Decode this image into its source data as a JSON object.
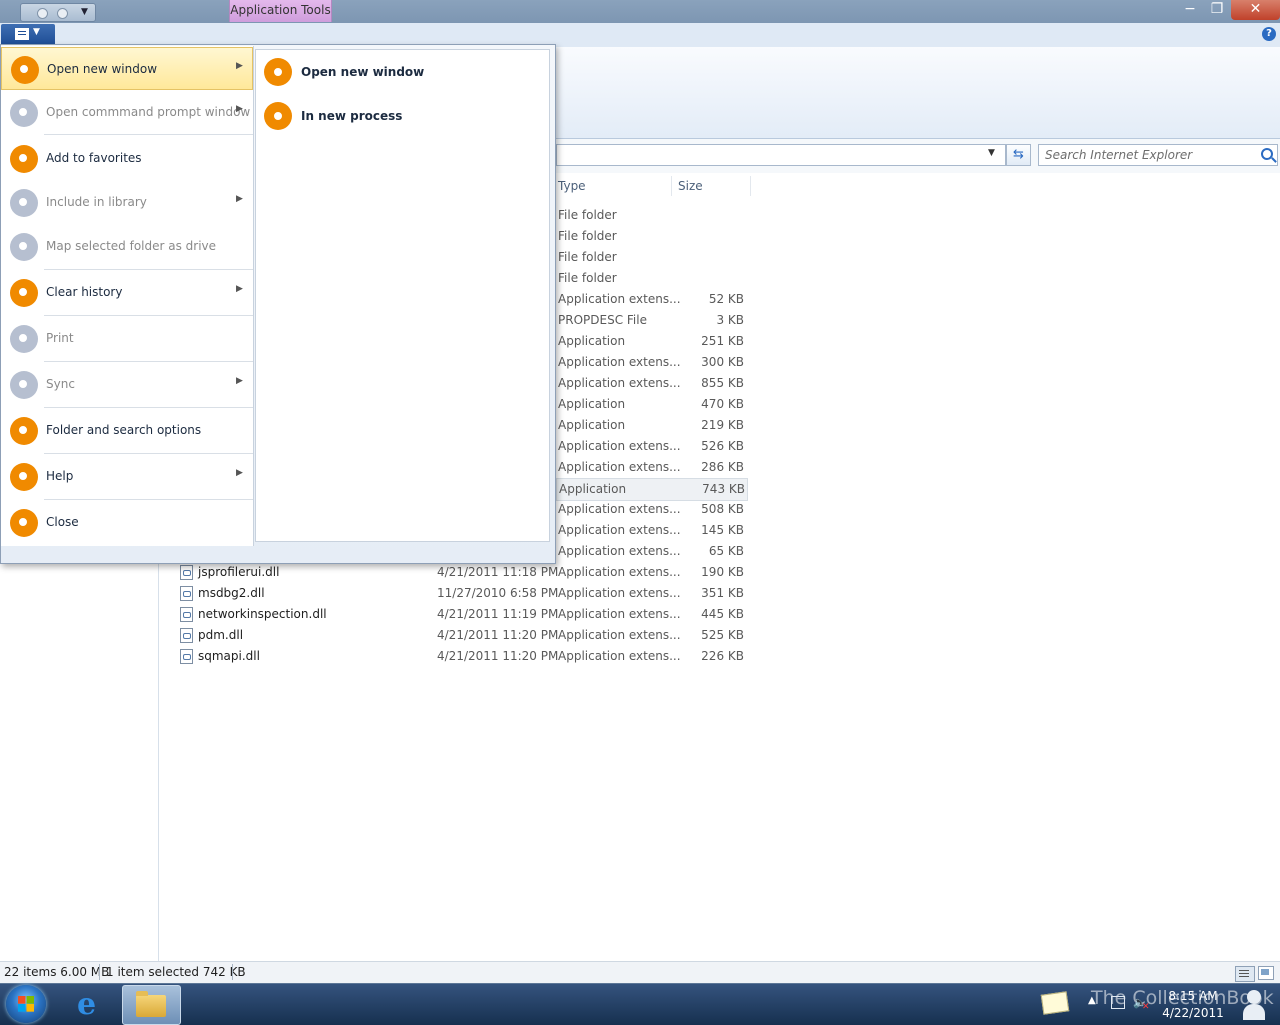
{
  "window": {
    "context_tab": "Application Tools",
    "minimize_glyph": "−",
    "maximize_glyph": "❐",
    "close_glyph": "✕",
    "help_glyph": "?"
  },
  "address": {
    "search_placeholder": "Search Internet Explorer",
    "refresh_glyph": "⇆",
    "dropdown_glyph": "▼"
  },
  "columns": {
    "type": "Type",
    "size": "Size"
  },
  "rows_partial": [
    {
      "type": "File folder",
      "size": ""
    },
    {
      "type": "File folder",
      "size": ""
    },
    {
      "type": "File folder",
      "size": ""
    },
    {
      "type": "File folder",
      "size": ""
    },
    {
      "type": "Application extens...",
      "size": "52 KB"
    },
    {
      "type": "PROPDESC File",
      "size": "3 KB"
    },
    {
      "type": "Application",
      "size": "251 KB"
    },
    {
      "type": "Application extens...",
      "size": "300 KB"
    },
    {
      "type": "Application extens...",
      "size": "855 KB"
    },
    {
      "type": "Application",
      "size": "470 KB"
    },
    {
      "type": "Application",
      "size": "219 KB"
    },
    {
      "type": "Application extens...",
      "size": "526 KB"
    },
    {
      "type": "Application extens...",
      "size": "286 KB"
    },
    {
      "type": "Application",
      "size": "743 KB",
      "selected": true
    },
    {
      "type": "Application extens...",
      "size": "508 KB"
    },
    {
      "type": "Application extens...",
      "size": "145 KB"
    },
    {
      "type": "Application extens...",
      "size": "65 KB"
    }
  ],
  "rows_full": [
    {
      "name": "jsprofilerui.dll",
      "date": "4/21/2011 11:18 PM",
      "type": "Application extens...",
      "size": "190 KB"
    },
    {
      "name": "msdbg2.dll",
      "date": "11/27/2010 6:58 PM",
      "type": "Application extens...",
      "size": "351 KB"
    },
    {
      "name": "networkinspection.dll",
      "date": "4/21/2011 11:19 PM",
      "type": "Application extens...",
      "size": "445 KB"
    },
    {
      "name": "pdm.dll",
      "date": "4/21/2011 11:20 PM",
      "type": "Application extens...",
      "size": "525 KB"
    },
    {
      "name": "sqmapi.dll",
      "date": "4/21/2011 11:20 PM",
      "type": "Application extens...",
      "size": "226 KB"
    }
  ],
  "app_menu": {
    "items": [
      {
        "label": "Open new window",
        "submenu": true,
        "disabled": false,
        "highlighted": true
      },
      {
        "label": "Open commmand prompt window",
        "submenu": true,
        "disabled": true
      },
      {
        "label": "Add to favorites",
        "submenu": false,
        "disabled": false
      },
      {
        "label": "Include in library",
        "submenu": true,
        "disabled": true
      },
      {
        "label": "Map selected folder as drive",
        "submenu": false,
        "disabled": true
      },
      {
        "label": "Clear history",
        "submenu": true,
        "disabled": false
      },
      {
        "label": "Print",
        "submenu": false,
        "disabled": true
      },
      {
        "label": "Sync",
        "submenu": true,
        "disabled": true
      },
      {
        "label": "Folder and search options",
        "submenu": false,
        "disabled": false
      },
      {
        "label": "Help",
        "submenu": true,
        "disabled": false
      },
      {
        "label": "Close",
        "submenu": false,
        "disabled": false
      }
    ],
    "submenu_items": [
      {
        "label": "Open new window"
      },
      {
        "label": "In new process"
      }
    ],
    "chevron_glyph": "▶"
  },
  "status": {
    "count": "22 items  6.00 MB",
    "selection": "1 item selected  742 KB"
  },
  "taskbar": {
    "ie_glyph": "e",
    "tray_arrow": "▲",
    "volume_glyph": "🔈",
    "volume_muted": "✕",
    "time": "8:15 AM",
    "date": "4/22/2011",
    "watermark": "The CollectionBook"
  },
  "colors": {
    "menu_orb": "#f08a00",
    "menu_orb_disabled": "#b6bfd0",
    "context_tab": "#cf9ddc",
    "highlight": "#ffe89a"
  },
  "icons": [
    "search-icon",
    "refresh-icon",
    "help-icon",
    "file-icon",
    "start-orb-icon",
    "ie-icon",
    "folder-icon",
    "show-desktop-icon"
  ]
}
